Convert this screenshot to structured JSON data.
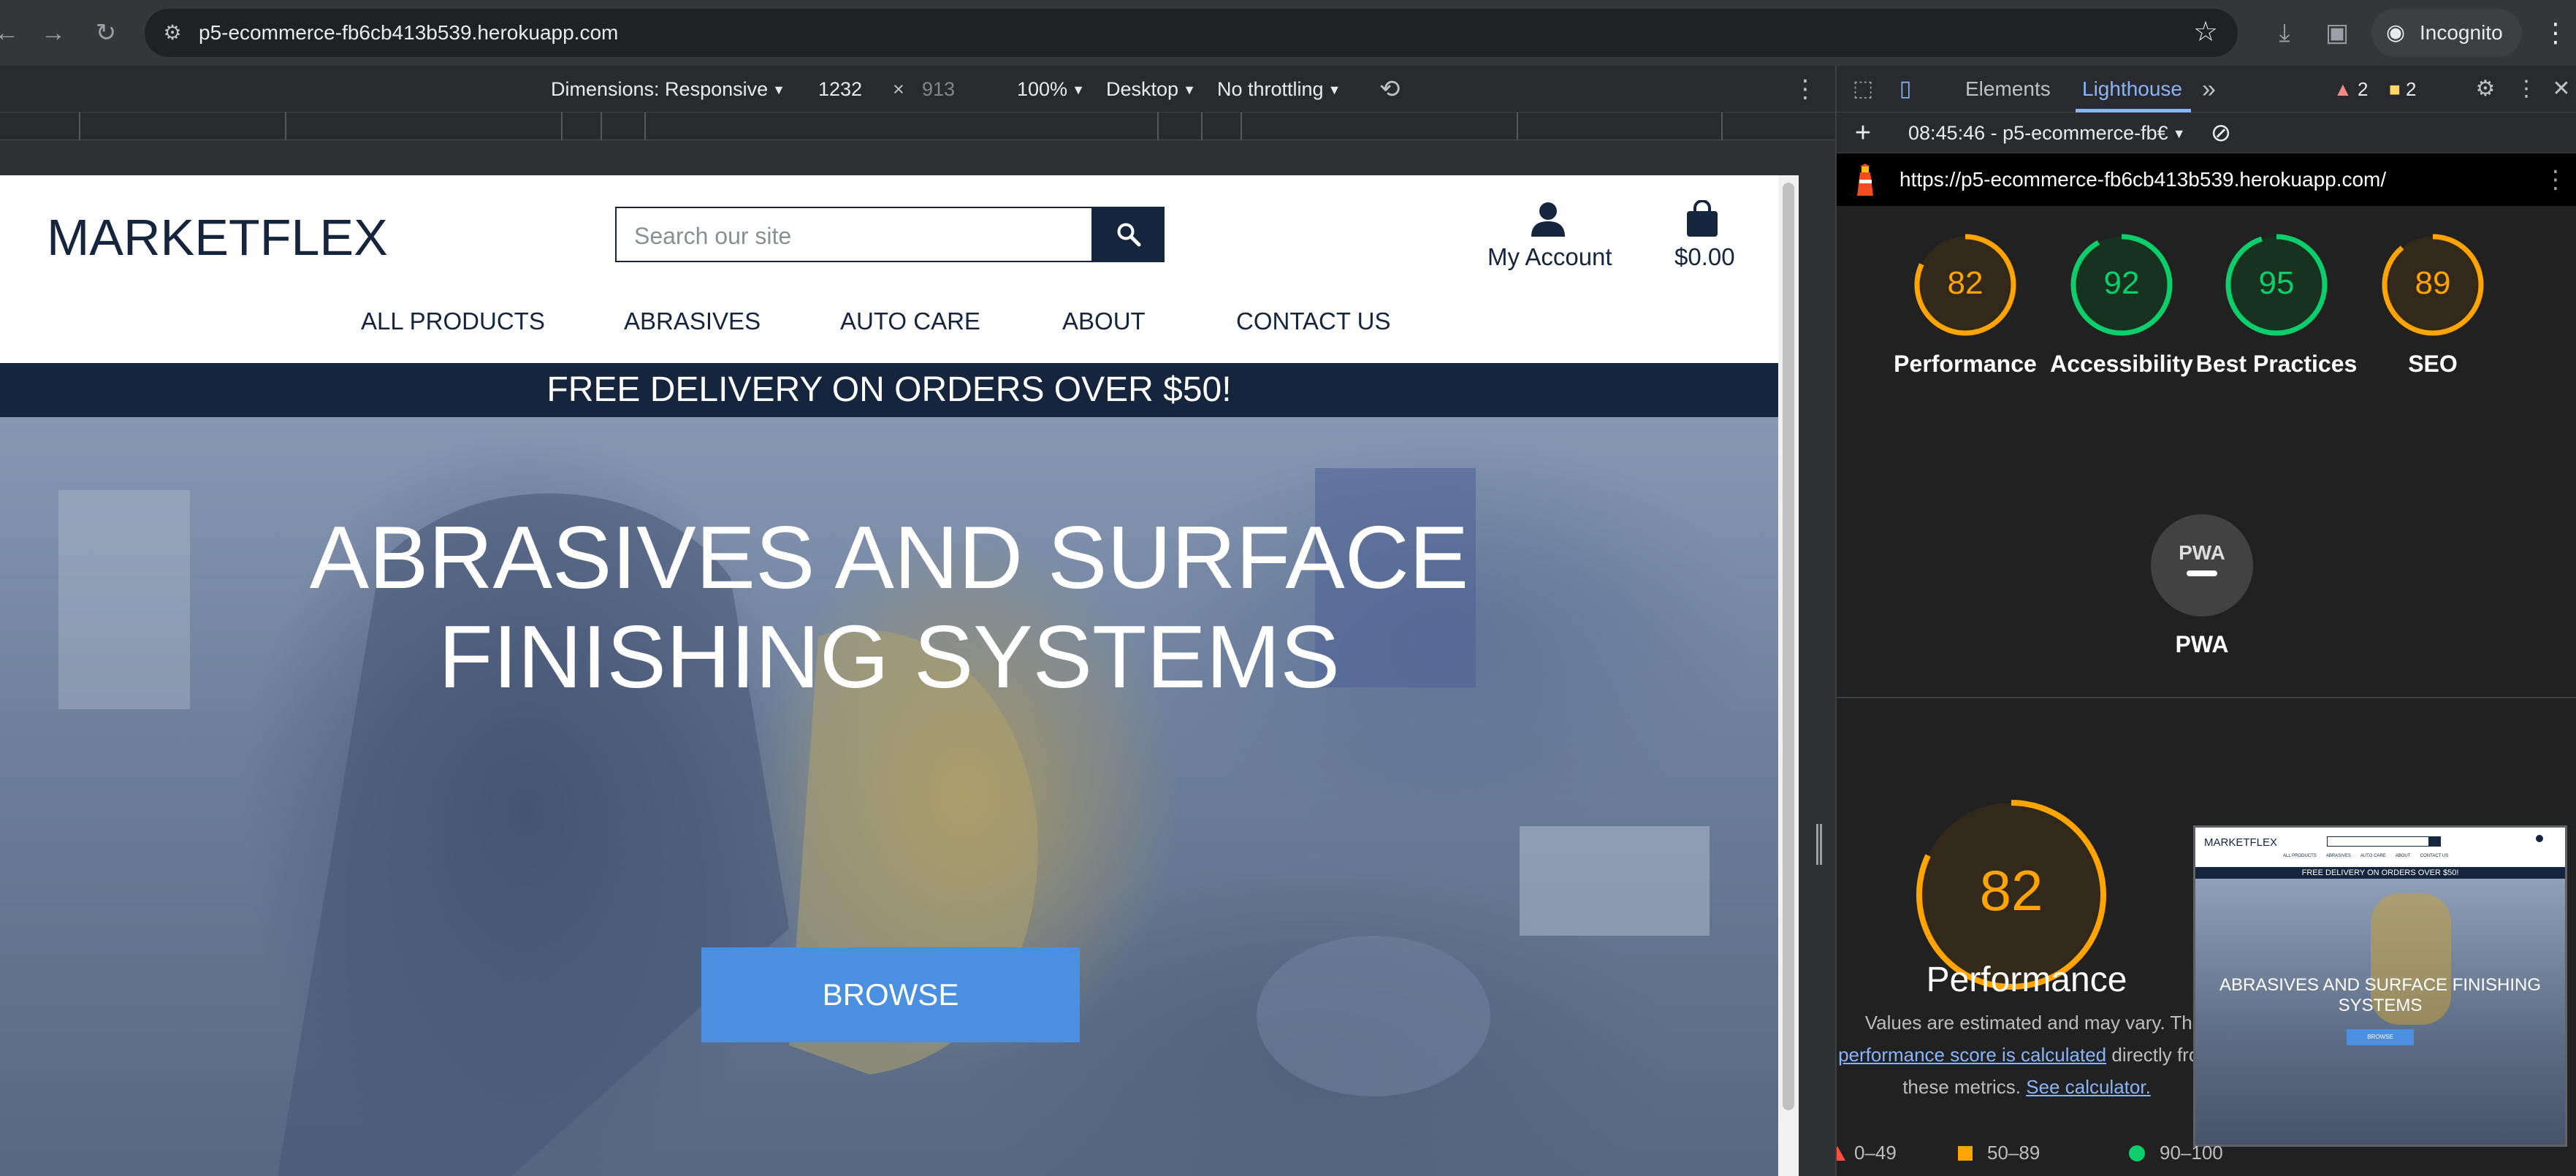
{
  "browser": {
    "url": "p5-ecommerce-fb6cb413b539.herokuapp.com",
    "incognito_label": "Incognito"
  },
  "device_toolbar": {
    "dimensions": "Dimensions: Responsive",
    "width": "1232",
    "times": "×",
    "height": "913",
    "zoom": "100%",
    "device_type": "Desktop",
    "throttling": "No throttling"
  },
  "site": {
    "logo": "MARKETFLEX",
    "search_placeholder": "Search our site",
    "account_label": "My Account",
    "bag_total": "$0.00",
    "nav": [
      "ALL PRODUCTS",
      "ABRASIVES",
      "AUTO CARE",
      "ABOUT",
      "CONTACT US"
    ],
    "banner": "FREE DELIVERY ON ORDERS OVER $50!",
    "hero_title_line1": "ABRASIVES AND SURFACE",
    "hero_title_line2": "FINISHING SYSTEMS",
    "browse_label": "BROWSE"
  },
  "devtools": {
    "tabs": [
      "Elements",
      "Lighthouse"
    ],
    "active_tab": "Lighthouse",
    "more_tabs": "»",
    "warnings_count": "2",
    "errors_count": "2",
    "report_selector": "08:45:46 - p5-ecommerce-fb€",
    "report_url": "https://p5-ecommerce-fb6cb413b539.herokuapp.com/",
    "scores": [
      {
        "name": "Performance",
        "value": 82,
        "color": "#ffa400"
      },
      {
        "name": "Accessibility",
        "value": 92,
        "color": "#0cce6b"
      },
      {
        "name": "Best Practices",
        "value": 95,
        "color": "#0cce6b"
      },
      {
        "name": "SEO",
        "value": 89,
        "color": "#ffa400"
      }
    ],
    "pwa": {
      "name": "PWA",
      "badge_text": "PWA",
      "badge_color": "#424242"
    },
    "performance_detail": {
      "score": 82,
      "label": "Performance",
      "note_prefix": "Values are estimated and may vary. The",
      "note_link": "performance score is calculated",
      "note_middle": "directly from",
      "note_suffix": "these metrics.",
      "calculator_link": "See calculator."
    },
    "legend": [
      {
        "range": "0–49",
        "color": "#ff4e42",
        "shape": "triangle"
      },
      {
        "range": "50–89",
        "color": "#ffa400",
        "shape": "square"
      },
      {
        "range": "90–100",
        "color": "#0cce6b",
        "shape": "circle"
      }
    ],
    "thumbnail": {
      "logo": "MARKETFLEX",
      "banner": "FREE DELIVERY ON ORDERS OVER $50!",
      "hero": "ABRASIVES AND SURFACE FINISHING SYSTEMS",
      "button": "BROWSE",
      "nav": [
        "ALL PRODUCTS",
        "ABRASIVES",
        "AUTO CARE",
        "ABOUT",
        "CONTACT US"
      ]
    }
  }
}
